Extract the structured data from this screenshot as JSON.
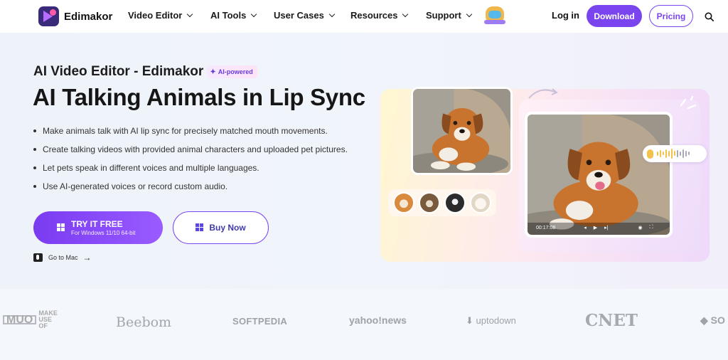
{
  "nav": {
    "brand": "Edimakor",
    "menu": [
      {
        "label": "Video Editor"
      },
      {
        "label": "AI Tools"
      },
      {
        "label": "User Cases"
      },
      {
        "label": "Resources"
      },
      {
        "label": "Support"
      }
    ],
    "login": "Log in",
    "download": "Download",
    "pricing": "Pricing"
  },
  "hero": {
    "subtitle": "AI Video Editor - Edimakor",
    "badge": "AI-powered",
    "headline": "AI Talking Animals in Lip Sync",
    "bullets": [
      "Make animals talk with AI lip sync for precisely matched mouth movements.",
      "Create talking videos with provided animal characters and uploaded pet pictures.",
      "Let pets speak in different voices and multiple languages.",
      "Use AI-generated voices or record custom audio."
    ],
    "try_label": "TRY IT FREE",
    "try_sub": "For Windows 11/10 64-bit",
    "buy_label": "Buy Now",
    "mac_link": "Go to Mac"
  },
  "player": {
    "time": "00:17:08"
  },
  "press": {
    "logos": [
      "MAKE USE OF",
      "Beebom",
      "SOFTPEDIA",
      "yahoo!news",
      "uptodown",
      "CNET",
      "SO"
    ]
  },
  "colors": {
    "accent": "#7a45ef",
    "hero_bg": "#eef3f9"
  }
}
